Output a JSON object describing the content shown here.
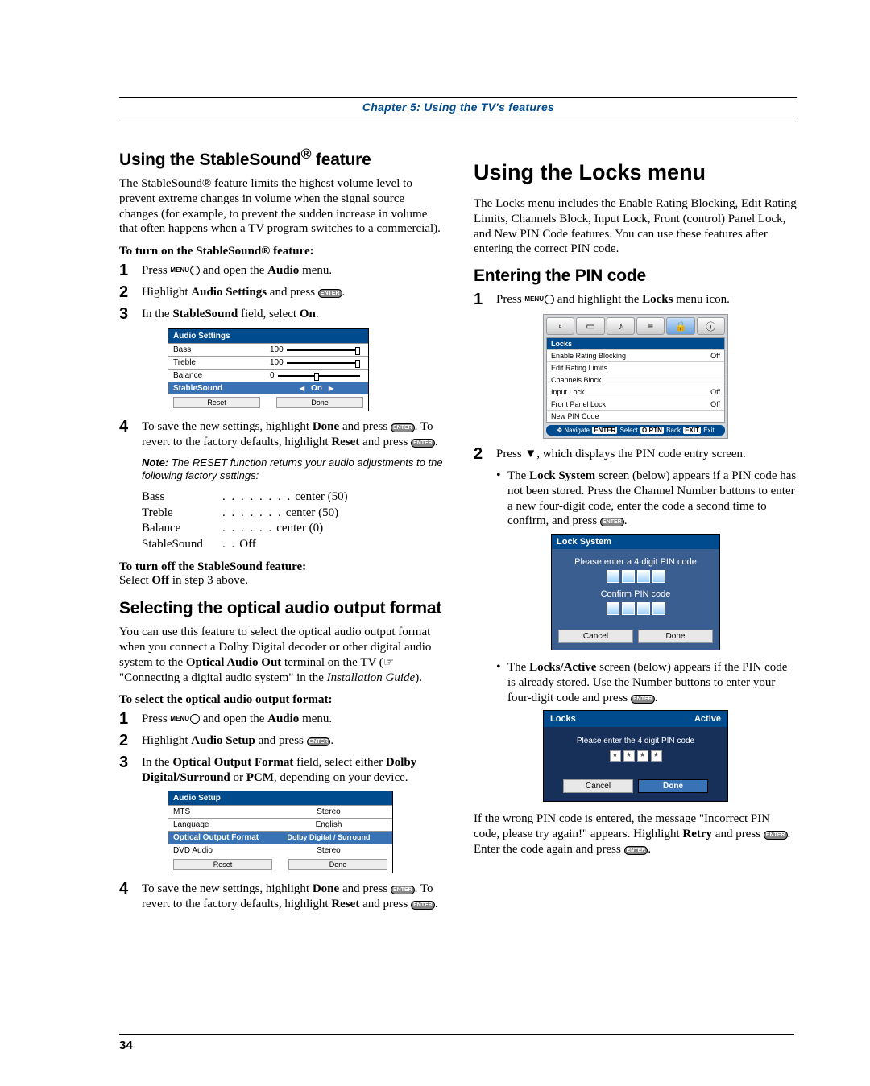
{
  "chapter": "Chapter 5: Using the TV's features",
  "page_number": "34",
  "left": {
    "h_stable": "Using the StableSound",
    "h_stable_suffix": " feature",
    "reg": "®",
    "p1": "The StableSound® feature limits the highest volume level to prevent extreme changes in volume when the signal source changes (for example, to prevent the sudden increase in volume that often happens when a TV program switches to a commercial).",
    "turn_on": "To turn on the StableSound® feature:",
    "s1a": "Press ",
    "s1b": " and open the ",
    "s1c": "Audio",
    "s1d": " menu.",
    "s2a": "Highlight ",
    "s2b": "Audio Settings",
    "s2c": " and press ",
    "s3a": "In the ",
    "s3b": "StableSound",
    "s3c": " field, select ",
    "s3d": "On",
    "audio_settings": {
      "hdr": "Audio Settings",
      "r1l": "Bass",
      "r1v": "100",
      "r2l": "Treble",
      "r2v": "100",
      "r3l": "Balance",
      "r3v": "0",
      "r4l": "StableSound",
      "r4v": "On",
      "reset": "Reset",
      "done": "Done"
    },
    "s4a": "To save the new settings, highlight ",
    "s4b": "Done",
    "s4c": " and press ",
    "s4d": ". To revert to the factory defaults, highlight ",
    "s4e": "Reset",
    "s4f": " and press ",
    "note_lead": "Note:",
    "note_body": " The RESET function returns your audio adjustments to the following factory settings:",
    "defs": {
      "bass_k": "Bass",
      "bass_v": "center (50)",
      "treble_k": "Treble",
      "treble_v": "center (50)",
      "balance_k": "Balance",
      "balance_v": "center (0)",
      "ss_k": "StableSound",
      "ss_v": "Off"
    },
    "turn_off": "To turn off the StableSound feature:",
    "turn_off_body_a": "Select ",
    "turn_off_body_b": "Off",
    "turn_off_body_c": " in step 3 above.",
    "h_opt": "Selecting the optical audio output format",
    "opt_p": "You can use this feature to select the optical audio output format when you connect a Dolby Digital decoder or other digital audio system to the ",
    "opt_term": "Optical Audio Out",
    "opt_p2": " terminal on the TV (",
    "opt_ref": "☞ \"Connecting a digital audio system\" in the ",
    "opt_ref_i": "Installation Guide",
    "opt_p3": ").",
    "opt_to": "To select the optical audio output format:",
    "o1a": "Press ",
    "o1b": " and open the ",
    "o1c": "Audio",
    "o1d": " menu.",
    "o2a": "Highlight ",
    "o2b": "Audio Setup",
    "o2c": " and press ",
    "o3a": "In the ",
    "o3b": "Optical Output Format",
    "o3c": " field, select either ",
    "o3d": "Dolby Digital/Surround",
    "o3e": " or ",
    "o3f": "PCM",
    "o3g": ", depending on your device.",
    "audio_setup": {
      "hdr": "Audio Setup",
      "r1l": "MTS",
      "r1v": "Stereo",
      "r2l": "Language",
      "r2v": "English",
      "r3l": "Optical Output Format",
      "r3v": "Dolby Digital / Surround",
      "r4l": "DVD Audio",
      "r4v": "Stereo",
      "reset": "Reset",
      "done": "Done"
    },
    "o4a": "To save the new settings, highlight ",
    "o4b": "Done",
    "o4c": " and press ",
    "o4d": ". To revert to the factory defaults, highlight ",
    "o4e": "Reset",
    "o4f": " and press "
  },
  "right": {
    "h_locks": "Using the Locks menu",
    "p1": "The Locks menu includes the Enable Rating Blocking, Edit Rating Limits, Channels Block, Input Lock, Front (control) Panel Lock, and New PIN Code features. You can use these features after entering the correct PIN code.",
    "h_pin": "Entering the PIN code",
    "s1a": "Press ",
    "s1b": " and highlight the ",
    "s1c": "Locks",
    "s1d": " menu icon.",
    "locks_menu": {
      "hdr": "Locks",
      "r1": "Enable Rating Blocking",
      "r1v": "Off",
      "r2": "Edit Rating Limits",
      "r3": "Channels Block",
      "r4": "Input Lock",
      "r4v": "Off",
      "r5": "Front Panel Lock",
      "r5v": "Off",
      "r6": "New PIN Code",
      "nav_navigate": "Navigate",
      "nav_select": "Select",
      "nav_back": "Back",
      "nav_exit": "Exit",
      "k_enter": "ENTER",
      "k_rtn": "O RTN",
      "k_exit": "EXIT"
    },
    "s2a": "Press ▼, which displays the PIN code entry screen.",
    "b1a": "The ",
    "b1b": "Lock System",
    "b1c": " screen (below) appears if a PIN code has not been stored. Press the Channel Number buttons to enter a new four-digit code, enter the code a second time to confirm, and press ",
    "locksys": {
      "hdr": "Lock System",
      "line1": "Please enter a 4 digit PIN code",
      "line2": "Confirm PIN code",
      "cancel": "Cancel",
      "done": "Done"
    },
    "b2a": "The ",
    "b2b": "Locks/Active",
    "b2c": " screen (below) appears if the PIN code is already stored. Use the Number buttons to enter your four-digit code and press ",
    "active": {
      "hdrL": "Locks",
      "hdrR": "Active",
      "line1": "Please enter the 4 digit PIN code",
      "star": "★",
      "cancel": "Cancel",
      "done": "Done"
    },
    "wrong_a": "If the wrong PIN code is entered, the message \"Incorrect PIN code, please try again!\" appears. Highlight ",
    "wrong_b": "Retry",
    "wrong_c": " and press ",
    "wrong_d": ". Enter the code again and press "
  }
}
